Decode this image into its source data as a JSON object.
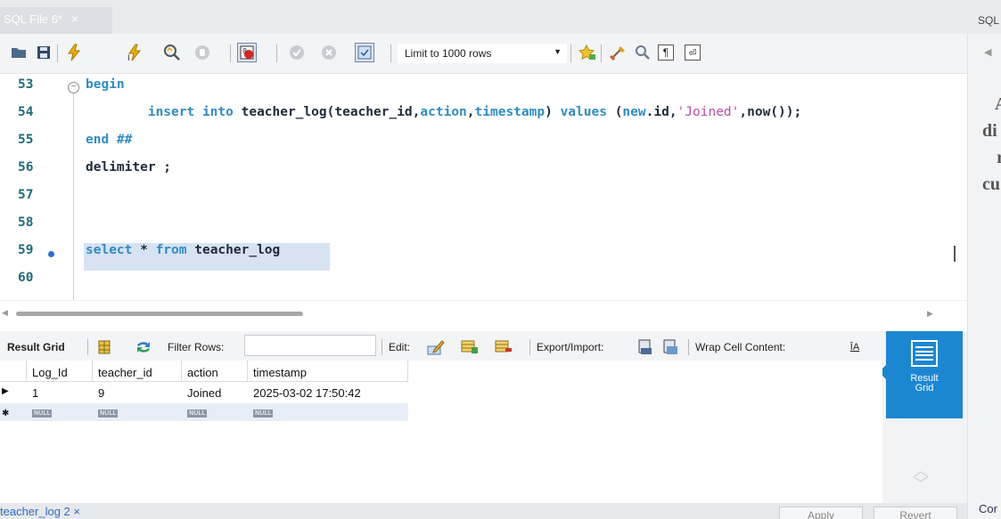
{
  "tabs": {
    "active_tab": "SQL File 6*",
    "close_glyph": "×",
    "right_tab": "SQL"
  },
  "toolbar": {
    "icons": [
      "open-folder-icon",
      "save-icon",
      "execute-icon",
      "execute-current-icon",
      "explain-icon",
      "stop-icon",
      "toggle-error-icon",
      "commit-icon",
      "rollback-icon",
      "autocommit-icon",
      "beautify-icon",
      "find-icon",
      "invisible-chars-icon",
      "wrap-icon"
    ],
    "limit_label": "Limit to 1000 rows"
  },
  "editor": {
    "lines": [
      {
        "num": "53",
        "text": "begin"
      },
      {
        "num": "54",
        "text": "        insert into teacher_log(teacher_id,action,timestamp) values (new.id,'Joined',now());"
      },
      {
        "num": "55",
        "text": "end ##"
      },
      {
        "num": "56",
        "text": "delimiter ;"
      },
      {
        "num": "57",
        "text": ""
      },
      {
        "num": "58",
        "text": ""
      },
      {
        "num": "59",
        "text": "select * from teacher_log"
      },
      {
        "num": "60",
        "text": ""
      }
    ]
  },
  "right_panel": {
    "text_lines": [
      "A",
      "di",
      "r",
      "cu"
    ],
    "bottom_text": "Cor"
  },
  "result_toolbar": {
    "result_grid": "Result Grid",
    "filter_rows": "Filter Rows:",
    "filter_value": "",
    "edit": "Edit:",
    "export_import": "Export/Import:",
    "wrap_cell": "Wrap Cell Content:"
  },
  "side_button": {
    "label_line1": "Result",
    "label_line2": "Grid"
  },
  "grid": {
    "columns": [
      "Log_Id",
      "teacher_id",
      "action",
      "timestamp"
    ],
    "rows": [
      [
        "1",
        "9",
        "Joined",
        "2025-03-02 17:50:42"
      ]
    ],
    "null_label": "NULL"
  },
  "bottom": {
    "tab_label": "teacher_log 2",
    "tab_close": "×",
    "apply": "Apply",
    "revert": "Revert"
  }
}
